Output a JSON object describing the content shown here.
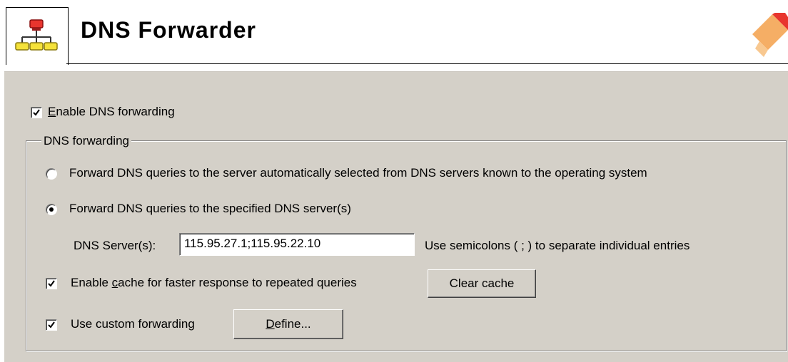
{
  "header": {
    "title": "DNS Forwarder",
    "icon": "network-hierarchy-icon"
  },
  "enable_forwarding": {
    "label_underlined": "E",
    "label_rest": "nable DNS forwarding",
    "checked": true
  },
  "group": {
    "legend": "DNS forwarding",
    "radio_auto_label": "Forward DNS queries to the server automatically selected from DNS servers known to the operating system",
    "radio_specified_label": "Forward DNS queries to the specified DNS server(s)",
    "selected": "specified",
    "dns_servers_label": "DNS Server(s):",
    "dns_servers_value": "115.95.27.1;115.95.22.10",
    "dns_servers_hint": "Use semicolons ( ; ) to separate individual entries",
    "cache": {
      "label_pre": "Enable ",
      "label_underlined": "c",
      "label_post": "ache for faster response to repeated queries",
      "checked": true,
      "clear_button": "Clear cache"
    },
    "custom": {
      "label": "Use custom forwarding",
      "checked": true,
      "define_underlined": "D",
      "define_rest": "efine..."
    }
  }
}
